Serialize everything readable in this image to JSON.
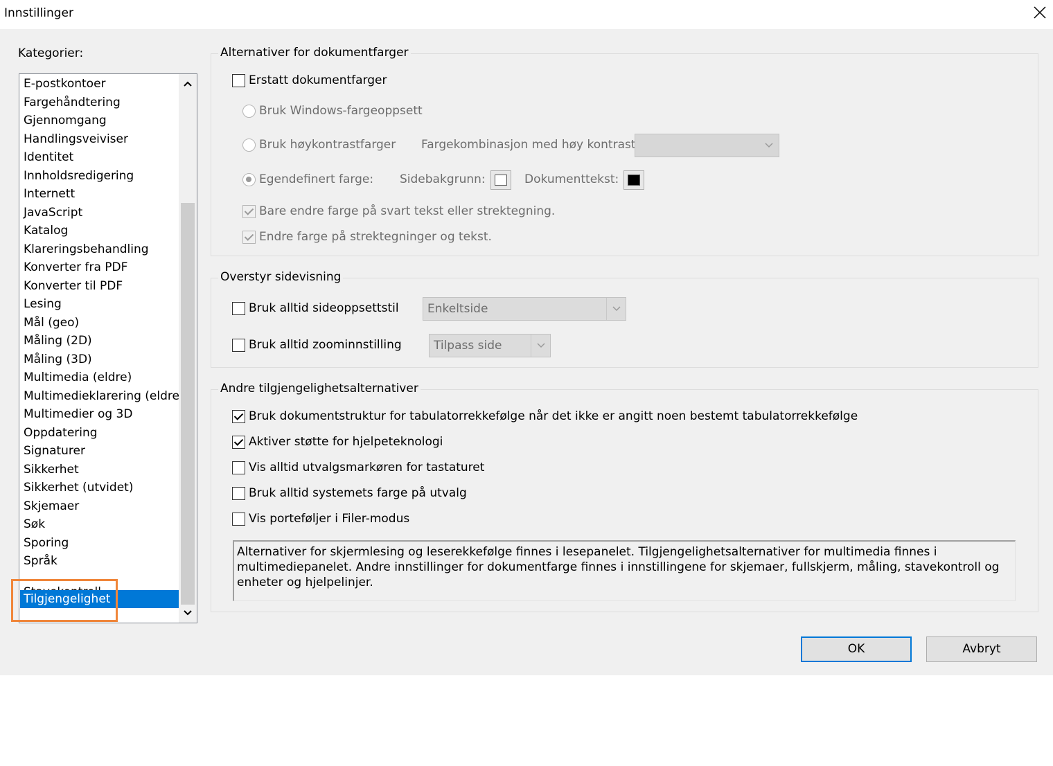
{
  "window": {
    "title": "Innstillinger",
    "close_icon": "close-icon"
  },
  "categories": {
    "label": "Kategorier:",
    "items": [
      "E-postkontoer",
      "Fargehåndtering",
      "Gjennomgang",
      "Handlingsveiviser",
      "Identitet",
      "Innholdsredigering",
      "Internett",
      "JavaScript",
      "Katalog",
      "Klareringsbehandling",
      "Konverter fra PDF",
      "Konverter til PDF",
      "Lesing",
      "Mål (geo)",
      "Måling (2D)",
      "Måling (3D)",
      "Multimedia (eldre)",
      "Multimedieklarering (eldre)",
      "Multimedier og 3D",
      "Oppdatering",
      "Signaturer",
      "Sikkerhet",
      "Sikkerhet (utvidet)",
      "Skjemaer",
      "Søk",
      "Sporing",
      "Språk",
      "Stavekontroll",
      "Tilgjengelighet"
    ],
    "selected": "Tilgjengelighet",
    "accent": "#0078d7",
    "highlight_color": "#f0863a"
  },
  "document_colors": {
    "title": "Alternativer for dokumentfarger",
    "replace_label": "Erstatt dokumentfarger",
    "replace_checked": false,
    "windows_scheme_label": "Bruk Windows-fargeoppsett",
    "high_contrast_label": "Bruk høykontrastfarger",
    "high_contrast_combo_label": "Fargekombinasjon med høy kontrast:",
    "high_contrast_combo_value": "",
    "custom_color_label": "Egendefinert farge:",
    "custom_color_selected": true,
    "page_background_label": "Sidebakgrunn:",
    "page_background_color": "#ffffff",
    "document_text_label": "Dokumenttekst:",
    "document_text_color": "#000000",
    "only_black_text_label": "Bare endre farge på svart tekst eller strektegning.",
    "only_black_text_checked": true,
    "change_line_art_label": "Endre farge på strektegninger og tekst.",
    "change_line_art_checked": true
  },
  "page_display": {
    "title": "Overstyr sidevisning",
    "layout_label": "Bruk alltid sideoppsettstil",
    "layout_checked": false,
    "layout_value": "Enkeltside",
    "zoom_label": "Bruk alltid zoominnstilling",
    "zoom_checked": false,
    "zoom_value": "Tilpass side"
  },
  "other_accessibility": {
    "title": "Andre tilgjengelighetsalternativer",
    "options": [
      {
        "label": "Bruk dokumentstruktur for tabulatorrekkefølge når det ikke er angitt noen bestemt tabulatorrekkefølge",
        "checked": true
      },
      {
        "label": "Aktiver støtte for hjelpeteknologi",
        "checked": true
      },
      {
        "label": "Vis alltid utvalgsmarkøren for tastaturet",
        "checked": false
      },
      {
        "label": "Bruk alltid systemets farge på utvalg",
        "checked": false
      },
      {
        "label": "Vis porteføljer i Filer-modus",
        "checked": false
      }
    ],
    "note": "Alternativer for skjermlesing og leserekkefølge finnes i lesepanelet. Tilgjengelighetsalternativer for multimedia finnes i multimediepanelet. Andre innstillinger for dokumentfarge finnes i innstillingene for skjemaer, fullskjerm, måling, stavekontroll og enheter og hjelpelinjer."
  },
  "buttons": {
    "ok": "OK",
    "cancel": "Avbryt"
  }
}
